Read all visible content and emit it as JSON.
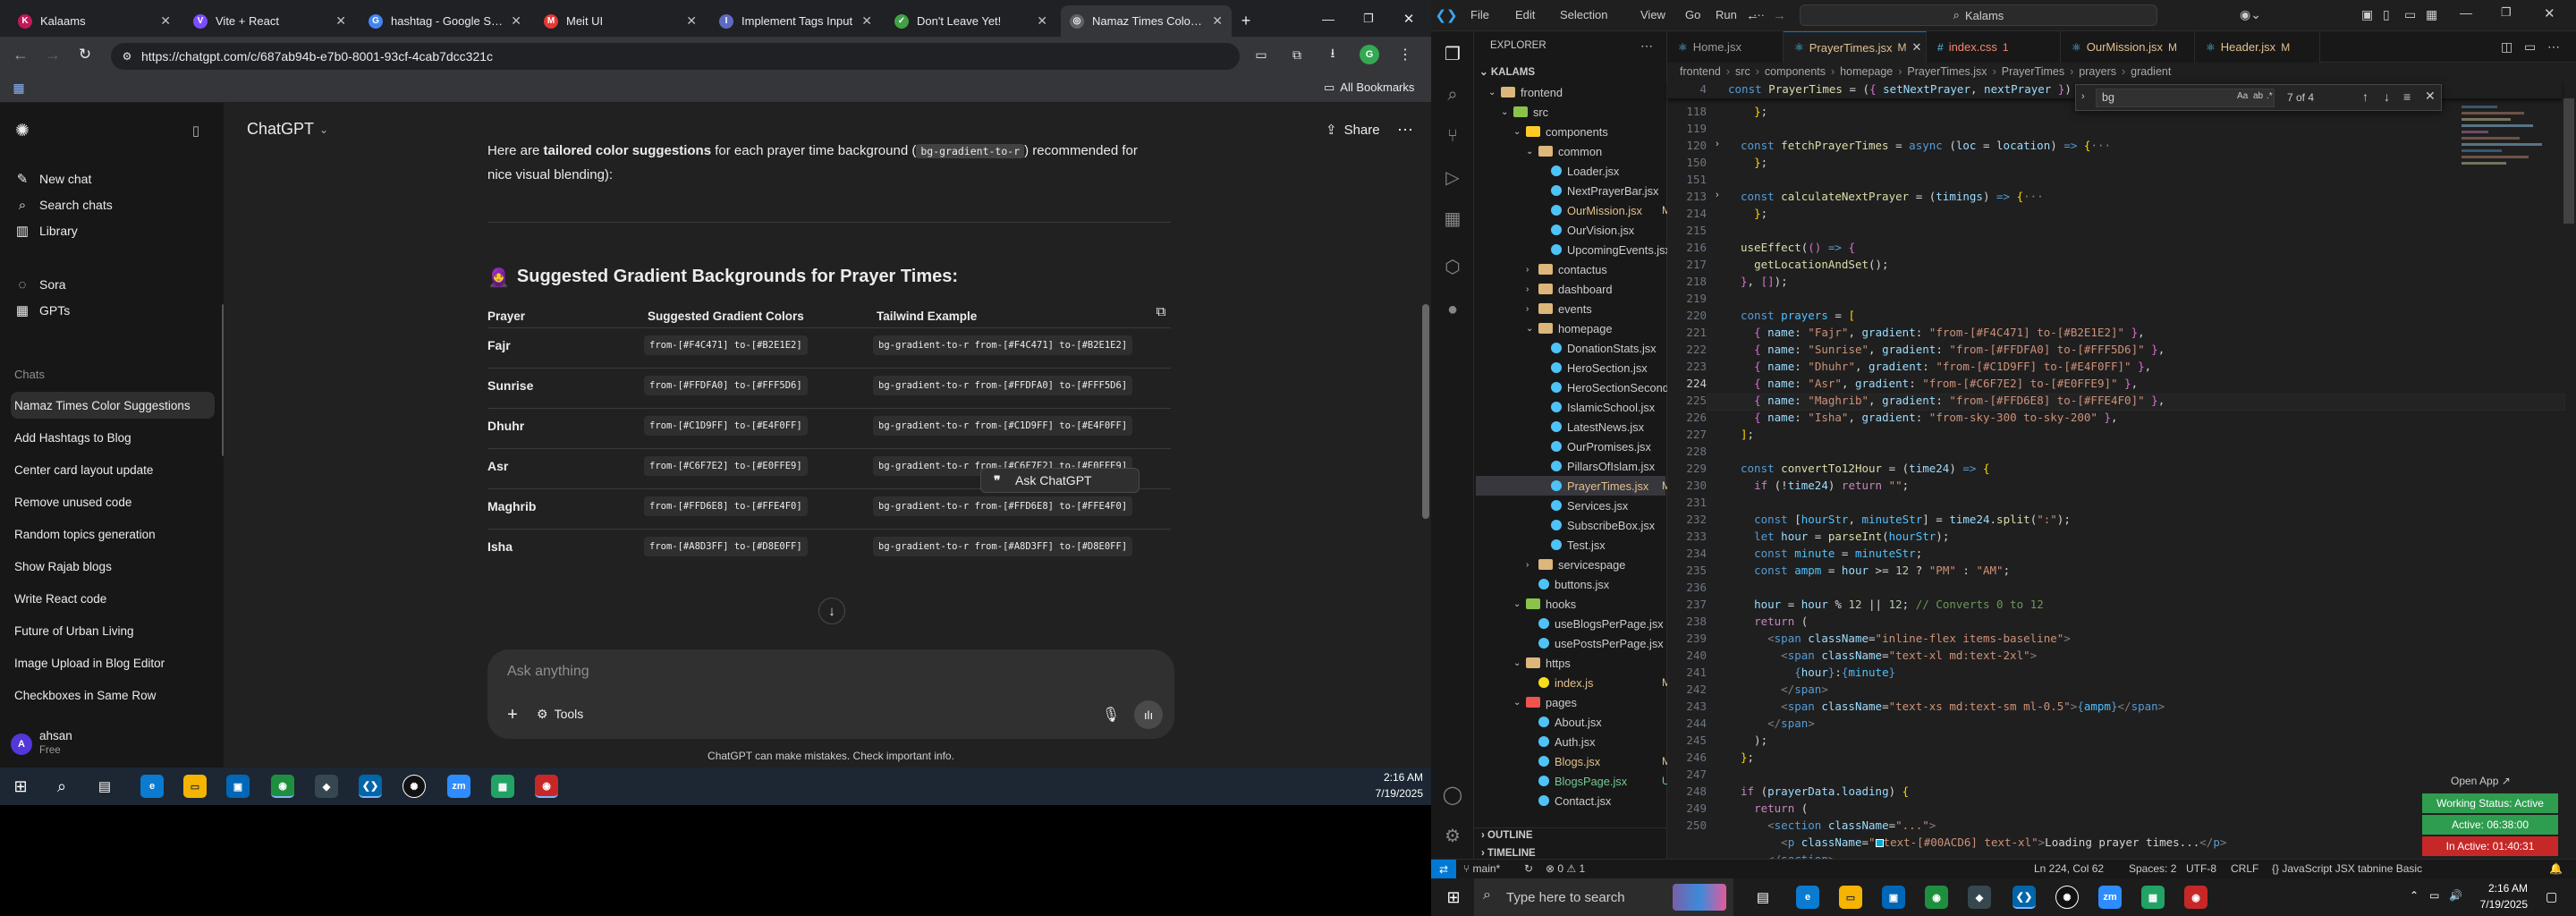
{
  "browser": {
    "tabs": [
      {
        "title": "Kalaams",
        "icon": "K",
        "color": "#c2185b"
      },
      {
        "title": "Vite + React",
        "icon": "V",
        "color": "#7c4dff"
      },
      {
        "title": "hashtag - Google Sea",
        "icon": "G",
        "color": "#4285f4"
      },
      {
        "title": "Meit UI",
        "icon": "M",
        "color": "#e53935"
      },
      {
        "title": "Implement Tags Input",
        "icon": "I",
        "color": "#5c6bc0"
      },
      {
        "title": "Don't Leave Yet!",
        "icon": "✓",
        "color": "#43a047"
      },
      {
        "title": "Namaz Times Color Sc",
        "icon": "◎",
        "color": "#5f6368"
      }
    ],
    "url": "https://chatgpt.com/c/687ab94b-e7b0-8001-93cf-4cab7dcc321c",
    "bookmarks_label": "All Bookmarks"
  },
  "chatgpt": {
    "model": "ChatGPT",
    "share_label": "Share",
    "nav": [
      {
        "label": "New chat",
        "icon": "edit-icon"
      },
      {
        "label": "Search chats",
        "icon": "search-icon"
      },
      {
        "label": "Library",
        "icon": "library-icon"
      },
      {
        "label": "Sora",
        "icon": "sora-icon"
      },
      {
        "label": "GPTs",
        "icon": "gpts-icon"
      }
    ],
    "chats_heading": "Chats",
    "chats": [
      "Namaz Times Color Suggestions",
      "Add Hashtags to Blog",
      "Center card layout update",
      "Remove unused code",
      "Random topics generation",
      "Show Rajab blogs",
      "Write React code",
      "Future of Urban Living",
      "Image Upload in Blog Editor",
      "Checkboxes in Same Row"
    ],
    "user": {
      "name": "ahsan",
      "plan": "Free",
      "initial": "A"
    },
    "intro_line1_a": "Here are ",
    "intro_line1_bold": "tailored color suggestions",
    "intro_line1_b": " for each prayer time background (",
    "intro_code": "bg-gradient-to-r",
    "intro_line1_c": ") recommended for",
    "intro_line2": "nice visual blending):",
    "section_emoji": "🧕",
    "section_title": "Suggested Gradient Backgrounds for Prayer Times:",
    "table_headers": [
      "Prayer",
      "Suggested Gradient Colors",
      "Tailwind Example"
    ],
    "rows": [
      {
        "prayer": "Fajr",
        "colors": "from-[#F4C471] to-[#B2E1E2]",
        "tailwind": "bg-gradient-to-r from-[#F4C471] to-[#B2E1E2]"
      },
      {
        "prayer": "Sunrise",
        "colors": "from-[#FFDFA0] to-[#FFF5D6]",
        "tailwind": "bg-gradient-to-r from-[#FFDFA0] to-[#FFF5D6]"
      },
      {
        "prayer": "Dhuhr",
        "colors": "from-[#C1D9FF] to-[#E4F0FF]",
        "tailwind": "bg-gradient-to-r from-[#C1D9FF] to-[#E4F0FF]"
      },
      {
        "prayer": "Asr",
        "colors": "from-[#C6F7E2] to-[#E0FFE9]",
        "tailwind": "bg-gradient-to-r from-[#C6F7E2] to-[#E0FFE9]"
      },
      {
        "prayer": "Maghrib",
        "colors": "from-[#FFD6E8] to-[#FFE4F0]",
        "tailwind": "bg-gradient-to-r from-[#FFD6E8] to-[#FFE4F0]"
      },
      {
        "prayer": "Isha",
        "colors": "from-[#A8D3FF] to-[#D8E0FF]",
        "tailwind": "bg-gradient-to-r from-[#A8D3FF] to-[#D8E0FF]"
      }
    ],
    "ask_popup": "Ask ChatGPT",
    "composer_placeholder": "Ask anything",
    "tools_label": "Tools",
    "disclaimer": "ChatGPT can make mistakes. Check important info."
  },
  "taskbar_left": {
    "time": "2:16 AM",
    "date": "7/19/2025"
  },
  "vscode": {
    "menus": [
      "File",
      "Edit",
      "Selection",
      "View",
      "Go",
      "Run",
      "···"
    ],
    "search": "Kalams",
    "explorer_title": "EXPLORER",
    "root": "KALAMS",
    "tree": [
      {
        "label": "frontend",
        "depth": 1,
        "type": "folder",
        "open": true,
        "color": "#dcb67a"
      },
      {
        "label": "src",
        "depth": 2,
        "type": "folder",
        "open": true,
        "color": "#8bc34a"
      },
      {
        "label": "components",
        "depth": 3,
        "type": "folder",
        "open": true,
        "color": "#ffca28"
      },
      {
        "label": "common",
        "depth": 4,
        "type": "folder",
        "open": true,
        "color": "#dcb67a"
      },
      {
        "label": "Loader.jsx",
        "depth": 5,
        "type": "file",
        "color": "#4fc3f7"
      },
      {
        "label": "NextPrayerBar.jsx",
        "depth": 5,
        "type": "file",
        "color": "#4fc3f7"
      },
      {
        "label": "OurMission.jsx",
        "depth": 5,
        "type": "file",
        "color": "#4fc3f7",
        "mark": "M"
      },
      {
        "label": "OurVision.jsx",
        "depth": 5,
        "type": "file",
        "color": "#4fc3f7"
      },
      {
        "label": "UpcomingEvents.jsx",
        "depth": 5,
        "type": "file",
        "color": "#4fc3f7"
      },
      {
        "label": "contactus",
        "depth": 4,
        "type": "folder",
        "open": false,
        "color": "#dcb67a"
      },
      {
        "label": "dashboard",
        "depth": 4,
        "type": "folder",
        "open": false,
        "color": "#dcb67a"
      },
      {
        "label": "events",
        "depth": 4,
        "type": "folder",
        "open": false,
        "color": "#dcb67a"
      },
      {
        "label": "homepage",
        "depth": 4,
        "type": "folder",
        "open": true,
        "color": "#dcb67a"
      },
      {
        "label": "DonationStats.jsx",
        "depth": 5,
        "type": "file",
        "color": "#4fc3f7"
      },
      {
        "label": "HeroSection.jsx",
        "depth": 5,
        "type": "file",
        "color": "#4fc3f7"
      },
      {
        "label": "HeroSectionSecond.j...",
        "depth": 5,
        "type": "file",
        "color": "#4fc3f7"
      },
      {
        "label": "IslamicSchool.jsx",
        "depth": 5,
        "type": "file",
        "color": "#4fc3f7"
      },
      {
        "label": "LatestNews.jsx",
        "depth": 5,
        "type": "file",
        "color": "#4fc3f7"
      },
      {
        "label": "OurPromises.jsx",
        "depth": 5,
        "type": "file",
        "color": "#4fc3f7"
      },
      {
        "label": "PillarsOfIslam.jsx",
        "depth": 5,
        "type": "file",
        "color": "#4fc3f7"
      },
      {
        "label": "PrayerTimes.jsx",
        "depth": 5,
        "type": "file",
        "color": "#4fc3f7",
        "mark": "M",
        "selected": true
      },
      {
        "label": "Services.jsx",
        "depth": 5,
        "type": "file",
        "color": "#4fc3f7"
      },
      {
        "label": "SubscribeBox.jsx",
        "depth": 5,
        "type": "file",
        "color": "#4fc3f7"
      },
      {
        "label": "Test.jsx",
        "depth": 5,
        "type": "file",
        "color": "#4fc3f7"
      },
      {
        "label": "servicespage",
        "depth": 4,
        "type": "folder",
        "open": false,
        "color": "#dcb67a"
      },
      {
        "label": "buttons.jsx",
        "depth": 4,
        "type": "file",
        "color": "#4fc3f7"
      },
      {
        "label": "hooks",
        "depth": 3,
        "type": "folder",
        "open": true,
        "color": "#8bc34a"
      },
      {
        "label": "useBlogsPerPage.jsx",
        "depth": 4,
        "type": "file",
        "color": "#4fc3f7"
      },
      {
        "label": "usePostsPerPage.jsx",
        "depth": 4,
        "type": "file",
        "color": "#4fc3f7"
      },
      {
        "label": "https",
        "depth": 3,
        "type": "folder",
        "open": true,
        "color": "#dcb67a"
      },
      {
        "label": "index.js",
        "depth": 4,
        "type": "file",
        "color": "#f7df1e",
        "mark": "M"
      },
      {
        "label": "pages",
        "depth": 3,
        "type": "folder",
        "open": true,
        "color": "#ef5350"
      },
      {
        "label": "About.jsx",
        "depth": 4,
        "type": "file",
        "color": "#4fc3f7"
      },
      {
        "label": "Auth.jsx",
        "depth": 4,
        "type": "file",
        "color": "#4fc3f7"
      },
      {
        "label": "Blogs.jsx",
        "depth": 4,
        "type": "file",
        "color": "#4fc3f7",
        "mark": "M"
      },
      {
        "label": "BlogsPage.jsx",
        "depth": 4,
        "type": "file",
        "color": "#4fc3f7",
        "mark": "U"
      },
      {
        "label": "Contact.jsx",
        "depth": 4,
        "type": "file",
        "color": "#4fc3f7"
      }
    ],
    "outline_label": "OUTLINE",
    "timeline_label": "TIMELINE",
    "tabs": [
      {
        "label": "Home.jsx",
        "active": false
      },
      {
        "label": "PrayerTimes.jsx",
        "active": true,
        "mark": "M"
      },
      {
        "label": "index.css",
        "active": false,
        "mark": "1"
      },
      {
        "label": "OurMission.jsx",
        "active": false,
        "mark": "M"
      },
      {
        "label": "Header.jsx",
        "active": false,
        "mark": "M"
      }
    ],
    "breadcrumb": [
      "frontend",
      "src",
      "components",
      "homepage",
      "PrayerTimes.jsx",
      "PrayerTimes",
      "prayers",
      "gradient"
    ],
    "find_value": "bg",
    "find_count": "7 of 4",
    "sticky_line": "const PrayerTimes = ({ setNextPrayer, nextPrayer }) => {",
    "line_numbers": [
      "118",
      "119",
      "120",
      "150",
      "151",
      "213",
      "214",
      "215",
      "216",
      "217",
      "218",
      "219",
      "220",
      "221",
      "222",
      "223",
      "224",
      "225",
      "226",
      "227",
      "228",
      "229",
      "230",
      "231",
      "232",
      "233",
      "234",
      "235",
      "236",
      "237",
      "238",
      "239",
      "240",
      "241",
      "242",
      "243",
      "244",
      "245",
      "246",
      "247",
      "248",
      "249",
      "250"
    ],
    "editor_status_right": "Open App ↗",
    "badges": [
      {
        "label": "Working Status: Active",
        "color": "#2e9d4f"
      },
      {
        "label": "Active: 06:38:00",
        "color": "#2e9d4f"
      },
      {
        "label": "In Active: 01:40:31",
        "color": "#c62828"
      }
    ],
    "status_left": [
      "main*",
      "⊗ 0 ⚠ 1"
    ],
    "status_right": [
      "Ln 224, Col 62",
      "Spaces: 2",
      "UTF-8",
      "CRLF",
      "{} JavaScript JSX",
      "tabnine Basic"
    ]
  },
  "taskbar_right": {
    "search_placeholder": "Type here to search",
    "time": "2:16 AM",
    "date": "7/19/2025"
  }
}
